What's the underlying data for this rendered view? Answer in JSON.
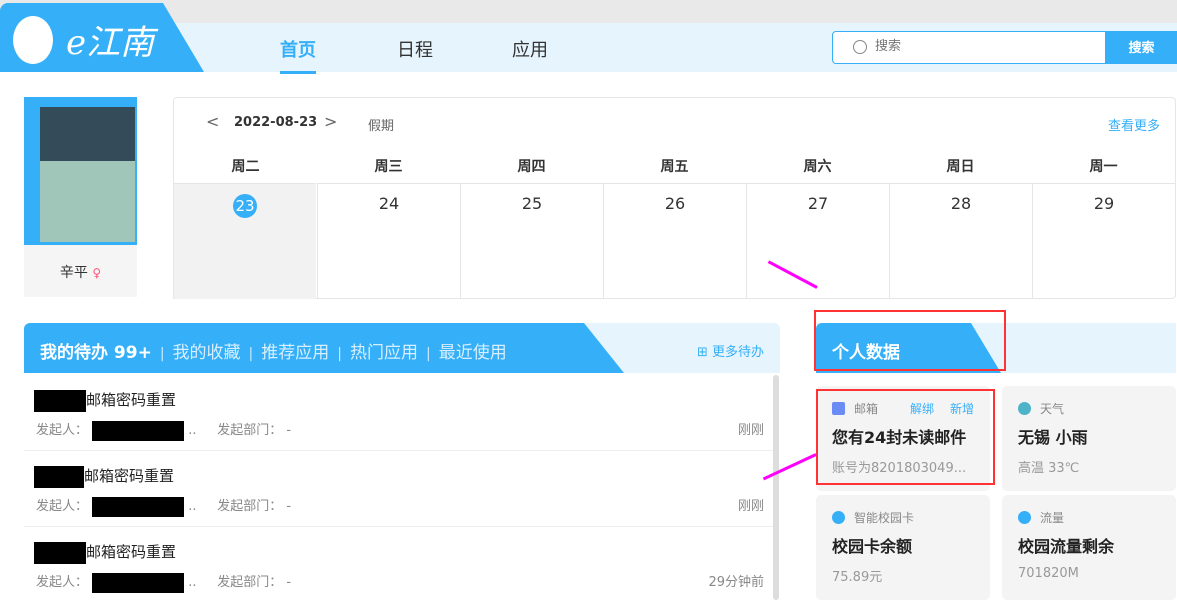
{
  "logo": {
    "text": "e江南"
  },
  "nav": {
    "tabs": [
      "首页",
      "日程",
      "应用"
    ]
  },
  "search": {
    "placeholder": "搜索",
    "button": "搜索"
  },
  "profile": {
    "name": "辛平",
    "gender_icon": "♀"
  },
  "calendar": {
    "date": "2022-08-23",
    "holiday": "假期",
    "more": "查看更多",
    "weekdays": [
      "周二",
      "周三",
      "周四",
      "周五",
      "周六",
      "周日",
      "周一"
    ],
    "days": [
      "23",
      "24",
      "25",
      "26",
      "27",
      "28",
      "29"
    ]
  },
  "todo": {
    "tabs": [
      "我的待办 99+",
      "我的收藏",
      "推荐应用",
      "热门应用",
      "最近使用"
    ],
    "more": "更多待办",
    "items": [
      {
        "title": "邮箱密码重置",
        "initiator_label": "发起人：",
        "dept_label": "发起部门：",
        "dept": "-",
        "time": "刚刚"
      },
      {
        "title": "邮箱密码重置",
        "initiator_label": "发起人：",
        "dept_label": "发起部门：",
        "dept": "-",
        "time": "刚刚"
      },
      {
        "title": "邮箱密码重置",
        "initiator_label": "发起人：",
        "dept_label": "发起部门：",
        "dept": "-",
        "time": "29分钟前"
      }
    ]
  },
  "personal": {
    "title": "个人数据",
    "cards": [
      {
        "label": "邮箱",
        "actions": [
          "解绑",
          "新增"
        ],
        "main": "您有24封未读邮件",
        "sub": "账号为8201803049..."
      },
      {
        "label": "天气",
        "main": "无锡 小雨",
        "sub": "高温 33℃"
      },
      {
        "label": "智能校园卡",
        "main": "校园卡余额",
        "sub": "75.89元"
      },
      {
        "label": "流量",
        "main": "校园流量剩余",
        "sub": "701820M"
      }
    ]
  }
}
